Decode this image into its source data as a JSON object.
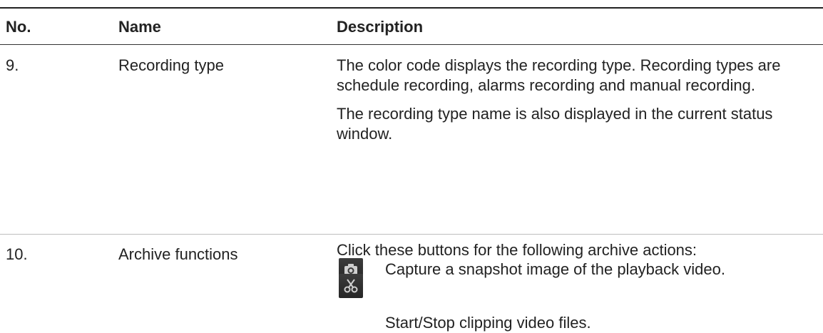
{
  "table": {
    "headers": {
      "no": "No.",
      "name": "Name",
      "description": "Description"
    },
    "rows": [
      {
        "no": "9.",
        "name": "Recording type",
        "paragraphs": [
          "The color code displays the recording type. Recording types are schedule recording, alarms recording and manual recording.",
          "The recording type name is also displayed in the current status window."
        ]
      },
      {
        "no": "10.",
        "name": "Archive functions",
        "intro": "Click these buttons for the following archive actions:",
        "actions": [
          {
            "icon": "camera-icon",
            "text": "Capture a snapshot image of the playback video."
          },
          {
            "icon": "scissors-icon",
            "text": "Start/Stop clipping video files."
          }
        ]
      }
    ]
  },
  "colors": {
    "text": "#222222",
    "icon_button_bg": "#2e2e2e",
    "icon_glyph": "#cfcfcf"
  }
}
